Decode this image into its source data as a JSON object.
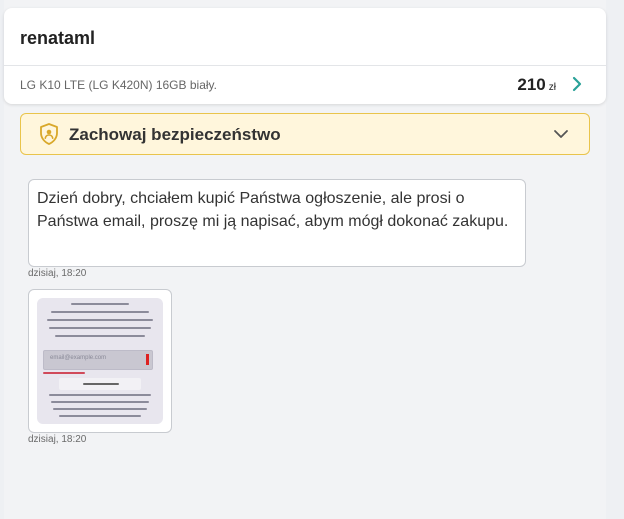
{
  "header": {
    "username": "renataml",
    "product": {
      "title": "LG K10 LTE (LG K420N) 16GB biały.",
      "price_value": "210",
      "price_currency": "zł"
    }
  },
  "safety_banner": {
    "label": "Zachowaj bezpieczeństwo",
    "icon": "shield-user-icon",
    "color": "#fff6dc"
  },
  "messages": [
    {
      "type": "text",
      "text": "Dzień dobry, chciałem kupić Państwa ogłoszenie, ale prosi o Państwa email, proszę mi ją napisać, abym mógł dokonać zakupu.",
      "time": "dzisiaj, 18:20"
    },
    {
      "type": "image",
      "image_caption": "platformie „Allegro”, należy podać email sprzedawcy. Na wskazany email zostanie wysłane potwierdzenie dostarczenia kupującego",
      "field_placeholder": "email@example.com",
      "warning_title": "UWAGA",
      "time": "dzisiaj, 18:20"
    }
  ],
  "colors": {
    "accent": "#2aa198",
    "banner_border": "#e9c44b",
    "alert": "#dd2222"
  }
}
